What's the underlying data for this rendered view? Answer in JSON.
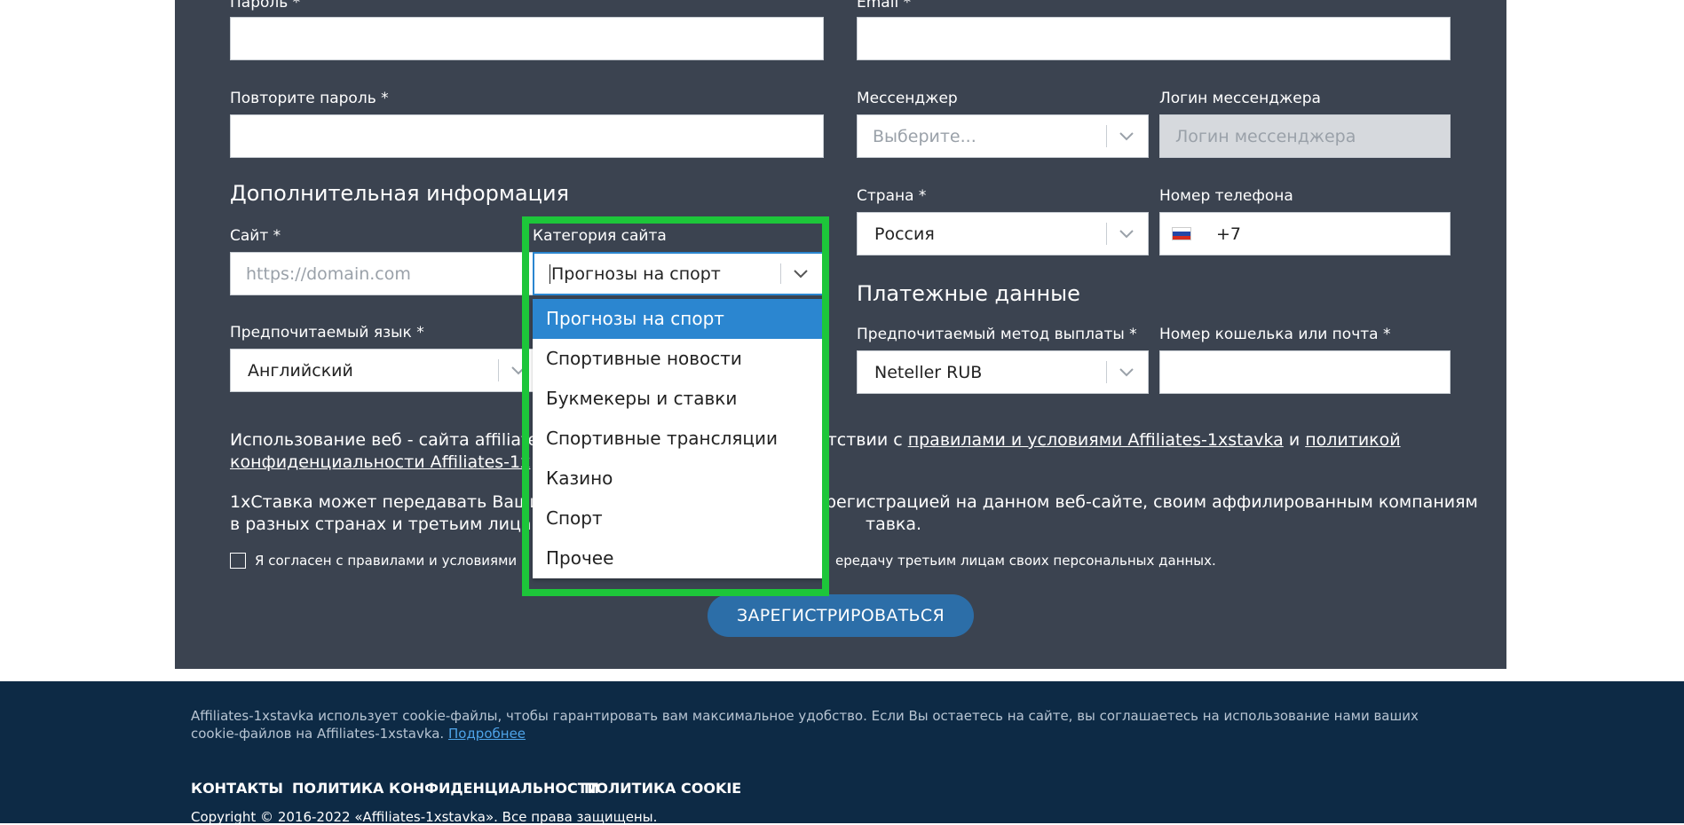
{
  "form": {
    "password_label": "Пароль *",
    "email_label": "Email *",
    "repeat_password_label": "Повторите пароль *",
    "messenger_label": "Мессенджер",
    "messenger_placeholder": "Выберите...",
    "messenger_login_label": "Логин мессенджера",
    "messenger_login_placeholder": "Логин мессенджера",
    "additional_info_title": "Дополнительная информация",
    "site_label": "Сайт *",
    "site_placeholder": "https://domain.com",
    "site_category_label": "Категория сайта",
    "site_category_value": "Прогнозы на спорт",
    "country_label": "Страна *",
    "country_value": "Россия",
    "phone_label": "Номер телефона",
    "phone_value": "+7",
    "language_label": "Предпочитаемый язык *",
    "language_value": "Английский",
    "payment_title": "Платежные данные",
    "payout_method_label": "Предпочитаемый метод выплаты *",
    "payout_method_value": "Neteller RUB",
    "wallet_label": "Номер кошелька или почта *"
  },
  "category_dropdown": {
    "options": [
      "Прогнозы на спорт",
      "Спортивные новости",
      "Букмекеры и ставки",
      "Спортивные трансляции",
      "Казино",
      "Спорт",
      "Прочее"
    ],
    "selected": "Прогнозы на спорт"
  },
  "terms": {
    "p1_start": "Использование веб - сайта affiliates",
    "p1_mid": "етствии с ",
    "p1_link1": "правилами и условиями Affiliates-1xstavka",
    "p1_and": " и ",
    "p1_link2a": "политикой",
    "p1_link2b": "конфиденциальности Affiliates-1x",
    "p2_line1_left": "1хСтавка может передавать Ваши",
    "p2_line1_right": "регистрацией на данном веб-сайте, своим аффилированным компаниям",
    "p2_line2_left": "в разных странах и третьим лицам",
    "p2_line2_right": "тавка.",
    "consent_left": "Я согласен с правилами и условиями и",
    "consent_right": "ередачу третьим лицам своих персональных данных."
  },
  "register_button": "ЗАРЕГИСТРИРОВАТЬСЯ",
  "footer": {
    "cookie_text": "Affiliates-1xstavka использует cookie-файлы, чтобы гарантировать вам максимальное удобство. Если Вы остаетесь на сайте, вы соглашаетесь на использование нами ваших cookie-файлов на Affiliates-1xstavka.",
    "cookie_link": "Подробнее",
    "links": [
      "КОНТАКТЫ",
      "ПОЛИТИКА КОНФИДЕНЦИАЛЬНОСТИ",
      "ПОЛИТИКА COOKIE"
    ],
    "copyright": "Copyright © 2016-2022 «Affiliates-1xstavka». Все права защищены."
  },
  "colors": {
    "panel_bg": "#3b4350",
    "footer_bg": "#0d2a45",
    "highlight": "#1dc63a",
    "selected_option": "#2b86d0",
    "register_button": "#2c6ea8"
  },
  "icons": [
    "chevron-down-icon",
    "russia-flag-icon"
  ]
}
